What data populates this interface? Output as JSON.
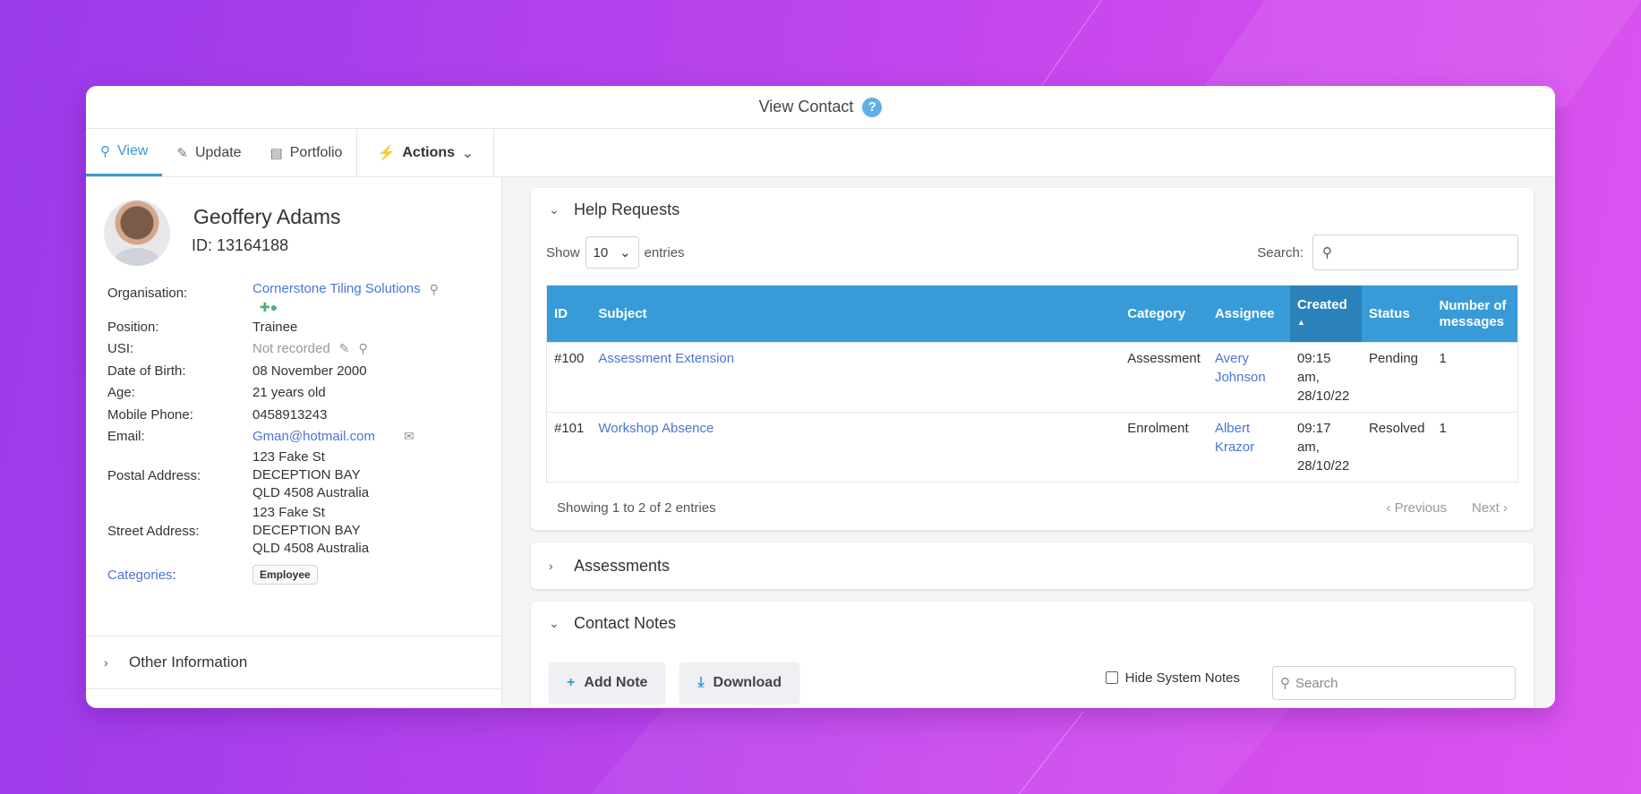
{
  "window": {
    "title": "View Contact"
  },
  "tabs": [
    {
      "label": "View",
      "icon": "search-icon",
      "active": true
    },
    {
      "label": "Update",
      "icon": "pencil-icon"
    },
    {
      "label": "Portfolio",
      "icon": "portfolio-icon"
    },
    {
      "label": "Actions",
      "icon": "bolt-icon"
    }
  ],
  "profile": {
    "name": "Geoffery Adams",
    "id_text": "ID: 13164188"
  },
  "details": {
    "organisation_label": "Organisation:",
    "organisation": "Cornerstone Tiling Solutions",
    "position_label": "Position:",
    "position": "Trainee",
    "usi_label": "USI:",
    "usi": "Not recorded",
    "dob_label": "Date of Birth:",
    "dob": "08 November 2000",
    "age_label": "Age:",
    "age": "21 years old",
    "mobile_label": "Mobile Phone:",
    "mobile": "0458913243",
    "email_label": "Email:",
    "email": "Gman@hotmail.com",
    "postal_label": "Postal Address:",
    "postal": [
      "123 Fake St",
      "DECEPTION BAY",
      "QLD 4508 Australia"
    ],
    "street_label": "Street Address:",
    "street": [
      "123 Fake St",
      "DECEPTION BAY",
      "QLD 4508 Australia"
    ],
    "categories_label": "Categories",
    "categories_colon": ":",
    "category_badge": "Employee"
  },
  "other_info": {
    "label": "Other Information"
  },
  "help_requests": {
    "title": "Help Requests",
    "show_label": "Show",
    "show_value": "10",
    "entries_label": "entries",
    "search_label": "Search:",
    "columns": [
      "ID",
      "Subject",
      "Category",
      "Assignee",
      "Created",
      "Status",
      "Number of messages"
    ],
    "rows": [
      {
        "id": "#100",
        "subject": "Assessment Extension",
        "category": "Assessment",
        "assignee": "Avery Johnson",
        "created": "09:15 am, 28/10/22",
        "status": "Pending",
        "messages": "1"
      },
      {
        "id": "#101",
        "subject": "Workshop Absence",
        "category": "Enrolment",
        "assignee": "Albert Krazor",
        "created": "09:17 am, 28/10/22",
        "status": "Resolved",
        "messages": "1"
      }
    ],
    "showing": "Showing 1 to 2 of 2 entries",
    "previous": "Previous",
    "next": "Next"
  },
  "assessments": {
    "title": "Assessments"
  },
  "contact_notes": {
    "title": "Contact Notes",
    "add_note": "Add Note",
    "download": "Download",
    "hide_system_notes": "Hide System Notes",
    "search_placeholder": "Search"
  },
  "colors": {
    "accent": "#3b96d4",
    "table_header": "#389bd8",
    "link": "#4a75d6"
  }
}
